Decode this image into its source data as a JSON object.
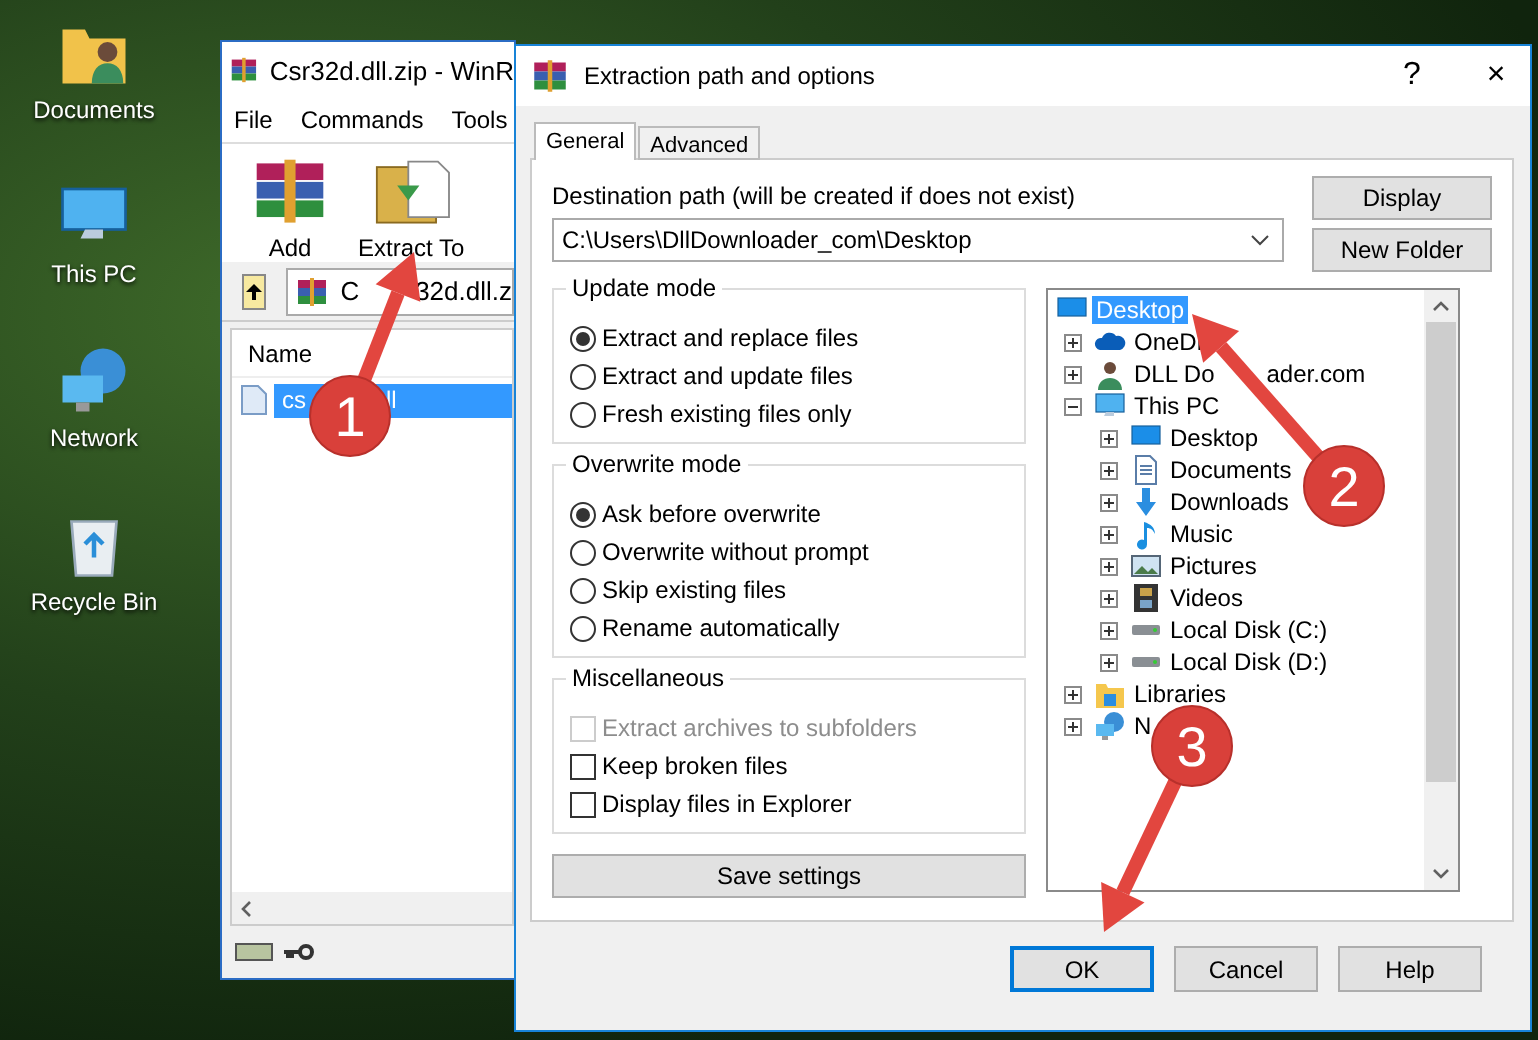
{
  "desktop_icons": [
    {
      "label": "Documents",
      "kind": "user-folder"
    },
    {
      "label": "This PC",
      "kind": "pc"
    },
    {
      "label": "Network",
      "kind": "network"
    },
    {
      "label": "Recycle Bin",
      "kind": "bin"
    }
  ],
  "archiver": {
    "title": "Csr32d.dll.zip - WinR",
    "menu": [
      "File",
      "Commands",
      "Tools"
    ],
    "toolbar": [
      {
        "label": "Add",
        "kind": "add"
      },
      {
        "label": "Extract To",
        "kind": "extract"
      }
    ],
    "path_parts": [
      "C",
      "32d.dll.z"
    ],
    "columns": [
      "Name"
    ],
    "files": [
      {
        "name_parts": [
          "cs",
          "ll"
        ],
        "selected": true
      }
    ]
  },
  "dialog": {
    "title": "Extraction path and options",
    "help": "?",
    "close": "×",
    "tabs": [
      {
        "label": "General",
        "selected": true
      },
      {
        "label": "Advanced",
        "selected": false
      }
    ],
    "destination_label": "Destination path (will be created if does not exist)",
    "destination_value": "C:\\Users\\DllDownloader_com\\Desktop",
    "side_buttons": [
      "Display",
      "New Folder"
    ],
    "groups": [
      {
        "title": "Update mode",
        "kind": "radio",
        "options": [
          {
            "label": "Extract and replace files",
            "selected": true
          },
          {
            "label": "Extract and update files",
            "selected": false
          },
          {
            "label": "Fresh existing files only",
            "selected": false
          }
        ]
      },
      {
        "title": "Overwrite mode",
        "kind": "radio",
        "options": [
          {
            "label": "Ask before overwrite",
            "selected": true
          },
          {
            "label": "Overwrite without prompt",
            "selected": false
          },
          {
            "label": "Skip existing files",
            "selected": false
          },
          {
            "label": "Rename automatically",
            "selected": false
          }
        ]
      },
      {
        "title": "Miscellaneous",
        "kind": "check",
        "options": [
          {
            "label": "Extract archives to subfolders",
            "checked": false,
            "disabled": true
          },
          {
            "label": "Keep broken files",
            "checked": false,
            "disabled": false
          },
          {
            "label": "Display files in Explorer",
            "checked": false,
            "disabled": false
          }
        ]
      }
    ],
    "save_button": "Save settings",
    "tree": [
      {
        "label": "Desktop",
        "kind": "desktop",
        "selected": true,
        "children": [
          {
            "label": "OneDr",
            "kind": "cloud",
            "selected": false,
            "expanded": false
          },
          {
            "label": "DLL Do",
            "label_end": "ader.com",
            "kind": "user",
            "selected": false,
            "expanded": false
          },
          {
            "label": "This PC",
            "kind": "pc",
            "selected": false,
            "expanded": true,
            "children": [
              {
                "label": "Desktop",
                "kind": "desktop",
                "selected": false,
                "expanded": false
              },
              {
                "label": "Documents",
                "kind": "documents",
                "selected": false,
                "expanded": false
              },
              {
                "label": "Downloads",
                "kind": "downloads",
                "selected": false,
                "expanded": false
              },
              {
                "label": "Music",
                "kind": "music",
                "selected": false,
                "expanded": false
              },
              {
                "label": "Pictures",
                "kind": "pictures",
                "selected": false,
                "expanded": false
              },
              {
                "label": "Videos",
                "kind": "videos",
                "selected": false,
                "expanded": false
              },
              {
                "label": "Local Disk (C:)",
                "kind": "disk",
                "selected": false,
                "expanded": false
              },
              {
                "label": "Local Disk (D:)",
                "kind": "disk",
                "selected": false,
                "expanded": false
              }
            ]
          },
          {
            "label": "Libraries",
            "kind": "libraries",
            "selected": false,
            "expanded": false
          },
          {
            "label": "N",
            "kind": "network",
            "selected": false,
            "expanded": false
          }
        ]
      }
    ],
    "footer_buttons": [
      {
        "label": "OK",
        "default": true
      },
      {
        "label": "Cancel",
        "default": false
      },
      {
        "label": "Help",
        "default": false
      }
    ]
  },
  "annotations": [
    {
      "label": "1"
    },
    {
      "label": "2"
    },
    {
      "label": "3"
    }
  ]
}
